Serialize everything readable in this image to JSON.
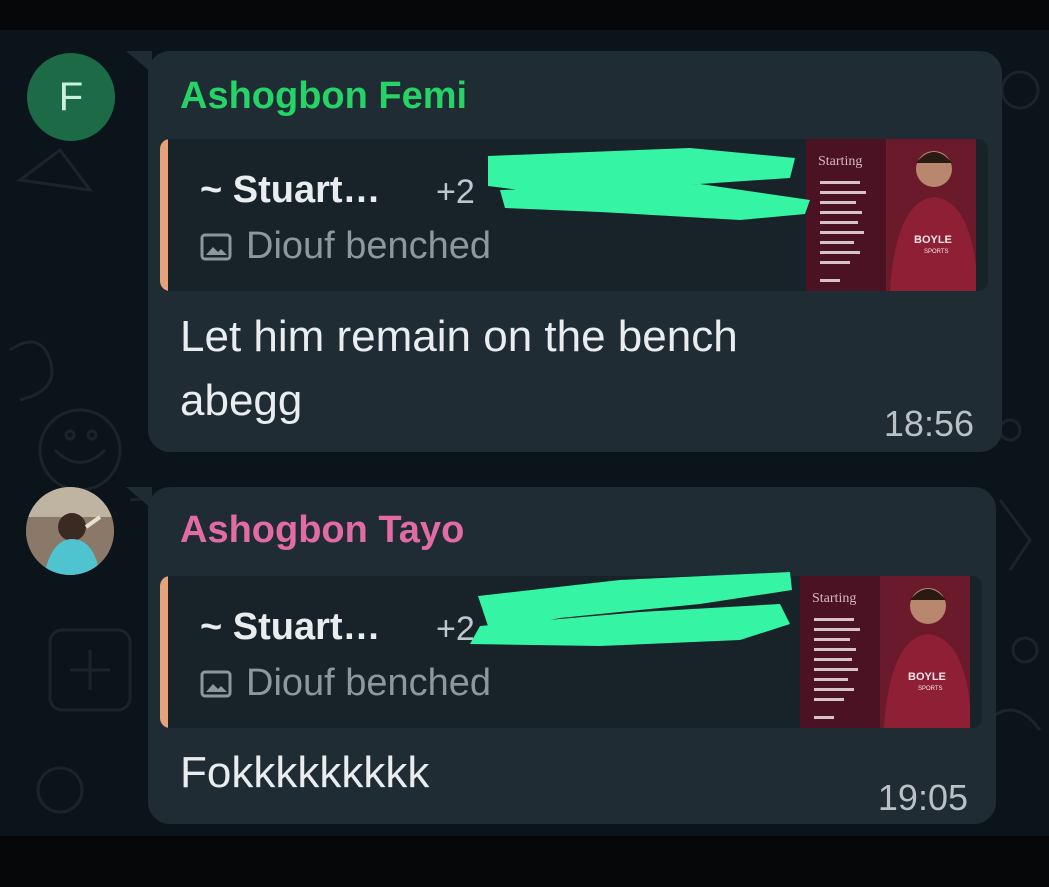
{
  "messages": [
    {
      "avatar_letter": "F",
      "sender": "Ashogbon Femi",
      "quote_author": "~ Stuart…",
      "quote_phone": "+2",
      "quote_caption": "Diouf benched",
      "text_lines": [
        "Let him remain on the bench",
        "abegg"
      ],
      "time": "18:56"
    },
    {
      "sender": "Ashogbon Tayo",
      "quote_author": "~ Stuart…",
      "quote_phone": "+2",
      "quote_caption": "Diouf benched",
      "text": "Fokkkkkkkkk",
      "time": "19:05"
    }
  ],
  "thumbnail": {
    "heading": "Starting",
    "sponsor": "BOYLE",
    "sponsor_sub": "SPORTS"
  },
  "colors": {
    "background": "#0b141a",
    "bubble": "#1f2c34",
    "sender_green": "#25d366",
    "sender_pink": "#e26ba5",
    "quote_bar": "#e6a27a",
    "redaction": "#35f5a5"
  }
}
